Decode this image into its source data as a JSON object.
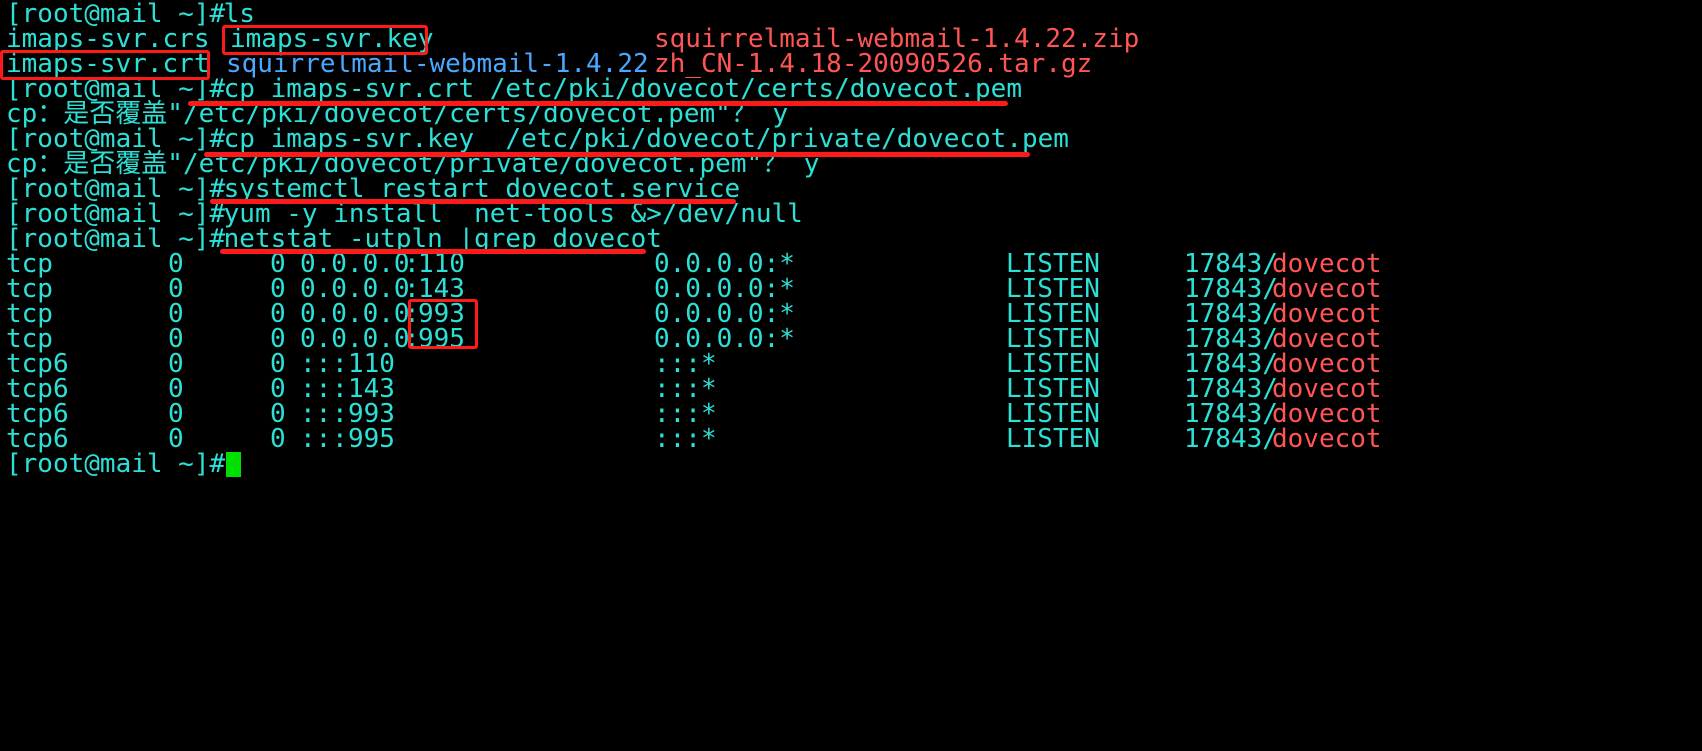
{
  "prompt": "[root@mail ~]#",
  "lines": {
    "l1_cmd": " ls",
    "l2": [
      "imaps-svr.crs",
      "imaps-svr.key",
      "squirrelmail-webmail-1.4.22.zip"
    ],
    "l3": [
      "imaps-svr.crt",
      "squirrelmail-webmail-1.4.22",
      "zh_CN-1.4.18-20090526.tar.gz"
    ],
    "l4_cmd": " cp imaps-svr.crt /etc/pki/dovecot/certs/dovecot.pem",
    "l5": "cp：是否覆盖\"/etc/pki/dovecot/certs/dovecot.pem\"？ y",
    "l6_cmd": " cp imaps-svr.key  /etc/pki/dovecot/private/dovecot.pem",
    "l7": "cp：是否覆盖\"/etc/pki/dovecot/private/dovecot.pem\"？ y",
    "l8_cmd": " systemctl restart dovecot.service",
    "l9_cmd": " yum -y install  net-tools &>/dev/null",
    "l10_cmd": " netstat -utpln |grep dovecot"
  },
  "netstat_rows": [
    {
      "proto": "tcp",
      "recvq": "0",
      "sendq": "0",
      "local_addr": "0.0.0.0",
      "local_port": "110",
      "foreign": "0.0.0.0:*",
      "state": "LISTEN",
      "pid": "17843/",
      "prog": "dovecot"
    },
    {
      "proto": "tcp",
      "recvq": "0",
      "sendq": "0",
      "local_addr": "0.0.0.0",
      "local_port": "143",
      "foreign": "0.0.0.0:*",
      "state": "LISTEN",
      "pid": "17843/",
      "prog": "dovecot"
    },
    {
      "proto": "tcp",
      "recvq": "0",
      "sendq": "0",
      "local_addr": "0.0.0.0",
      "local_port": "993",
      "foreign": "0.0.0.0:*",
      "state": "LISTEN",
      "pid": "17843/",
      "prog": "dovecot"
    },
    {
      "proto": "tcp",
      "recvq": "0",
      "sendq": "0",
      "local_addr": "0.0.0.0",
      "local_port": "995",
      "foreign": "0.0.0.0:*",
      "state": "LISTEN",
      "pid": "17843/",
      "prog": "dovecot"
    },
    {
      "proto": "tcp6",
      "recvq": "0",
      "sendq": "0",
      "local_addr": "::",
      "local_port": "110",
      "foreign": ":::*",
      "state": "LISTEN",
      "pid": "17843/",
      "prog": "dovecot"
    },
    {
      "proto": "tcp6",
      "recvq": "0",
      "sendq": "0",
      "local_addr": "::",
      "local_port": "143",
      "foreign": ":::*",
      "state": "LISTEN",
      "pid": "17843/",
      "prog": "dovecot"
    },
    {
      "proto": "tcp6",
      "recvq": "0",
      "sendq": "0",
      "local_addr": "::",
      "local_port": "993",
      "foreign": ":::*",
      "state": "LISTEN",
      "pid": "17843/",
      "prog": "dovecot"
    },
    {
      "proto": "tcp6",
      "recvq": "0",
      "sendq": "0",
      "local_addr": "::",
      "local_port": "995",
      "foreign": ":::*",
      "state": "LISTEN",
      "pid": "17843/",
      "prog": "dovecot"
    }
  ],
  "colors": {
    "background": "#000000",
    "text": "#2de0d6",
    "directory": "#4aa8ff",
    "archive": "#ff5555",
    "annotation": "#ff1a1a",
    "cursor": "#00e000"
  }
}
